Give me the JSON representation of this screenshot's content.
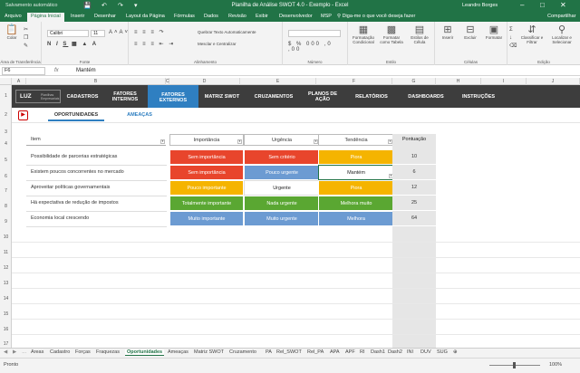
{
  "window": {
    "title": "Planilha de Análise SWOT 4.0 - Exemplo  -  Excel",
    "autosave": "Salvamento automático",
    "user": "Leandro Borges"
  },
  "ribbon_tabs": [
    "Arquivo",
    "Página Inicial",
    "Inserir",
    "Desenhar",
    "Layout da Página",
    "Fórmulas",
    "Dados",
    "Revisão",
    "Exibir",
    "Desenvolvedor",
    "MSP"
  ],
  "tell_me": "Diga-me o que você deseja fazer",
  "share": "Compartilhar",
  "ribbon": {
    "paste": "Colar",
    "font_name": "Calibri",
    "font_size": "11",
    "wrap_text": "Quebrar Texto Automaticamente",
    "merge": "Mesclar e Centralizar",
    "cond_format": "Formatação Condicional",
    "format_table": "Formatar como Tabela",
    "cell_styles": "Estilos de Célula",
    "insert": "Inserir",
    "delete": "Excluir",
    "format": "Formatar",
    "sort_filter": "Classificar e Filtrar",
    "find_select": "Localizar e Selecionar",
    "groups": [
      "Área de Transferência",
      "Fonte",
      "Alinhamento",
      "Número",
      "Estilo",
      "Células",
      "Edição"
    ]
  },
  "formula_bar": {
    "name_box": "F6",
    "fx": "fx",
    "value": "Mantém"
  },
  "columns": [
    "A",
    "B",
    "C",
    "D",
    "E",
    "F",
    "G",
    "H",
    "I",
    "J"
  ],
  "rows": [
    "1",
    "2",
    "3",
    "4",
    "5",
    "6",
    "7",
    "8",
    "9",
    "10",
    "11",
    "12",
    "13",
    "14",
    "15",
    "16",
    "17"
  ],
  "nav": {
    "logo": "LUZ",
    "logo_sub": "Planilhas Empresariais",
    "items": [
      "CADASTROS",
      "FATORES INTERNOS",
      "FATORES EXTERNOS",
      "MATRIZ SWOT",
      "CRUZAMENTOS",
      "PLANOS DE AÇÃO",
      "RELATÓRIOS",
      "DASHBOARDS",
      "INSTRUÇÕES"
    ]
  },
  "subtabs": [
    "OPORTUNIDADES",
    "AMEAÇAS"
  ],
  "table": {
    "headers": {
      "item": "Item",
      "importancia": "Importância",
      "urgencia": "Urgência",
      "tendencia": "Tendência",
      "pontuacao": "Pontuação"
    },
    "rows": [
      {
        "item": "Possibilidade de parcerias estratégicas",
        "importancia": "Sem importância",
        "urgencia": "Sem critério",
        "tendencia": "Piora",
        "pontuacao": "10"
      },
      {
        "item": "Existem poucos concorrentes no mercado",
        "importancia": "Sem importância",
        "urgencia": "Pouco urgente",
        "tendencia": "Mantém",
        "pontuacao": "6"
      },
      {
        "item": "Aproveitar políticas governamentais",
        "importancia": "Pouco importante",
        "urgencia": "Urgente",
        "tendencia": "Piora",
        "pontuacao": "12"
      },
      {
        "item": "Há expectativa de redução de impostos",
        "importancia": "Totalmente importante",
        "urgencia": "Nada urgente",
        "tendencia": "Melhora muito",
        "pontuacao": "25"
      },
      {
        "item": "Economia local crescendo",
        "importancia": "Muito importante",
        "urgencia": "Muito urgente",
        "tendencia": "Melhora",
        "pontuacao": "64"
      }
    ]
  },
  "colors": {
    "red": "#e8452c",
    "blue": "#6c9bd2",
    "yellow": "#f5b400",
    "green": "#5aa732",
    "white": "#ffffff",
    "excel_green": "#217346",
    "nav_blue": "#2f7fc1"
  },
  "sheet_tabs": [
    "Areas",
    "Cadastro",
    "Forças",
    "Fraquezas",
    "Oportunidades",
    "Ameaças",
    "Matriz SWOT",
    "Cruzamento",
    "PA",
    "Rel_SWOT",
    "Rel_PA",
    "APA",
    "APF",
    "RI",
    "Dash1",
    "Dash2",
    "INI",
    "DUV",
    "SUG"
  ],
  "active_sheet": "Oportunidades",
  "status": {
    "ready": "Pronto",
    "zoom": "100%"
  }
}
